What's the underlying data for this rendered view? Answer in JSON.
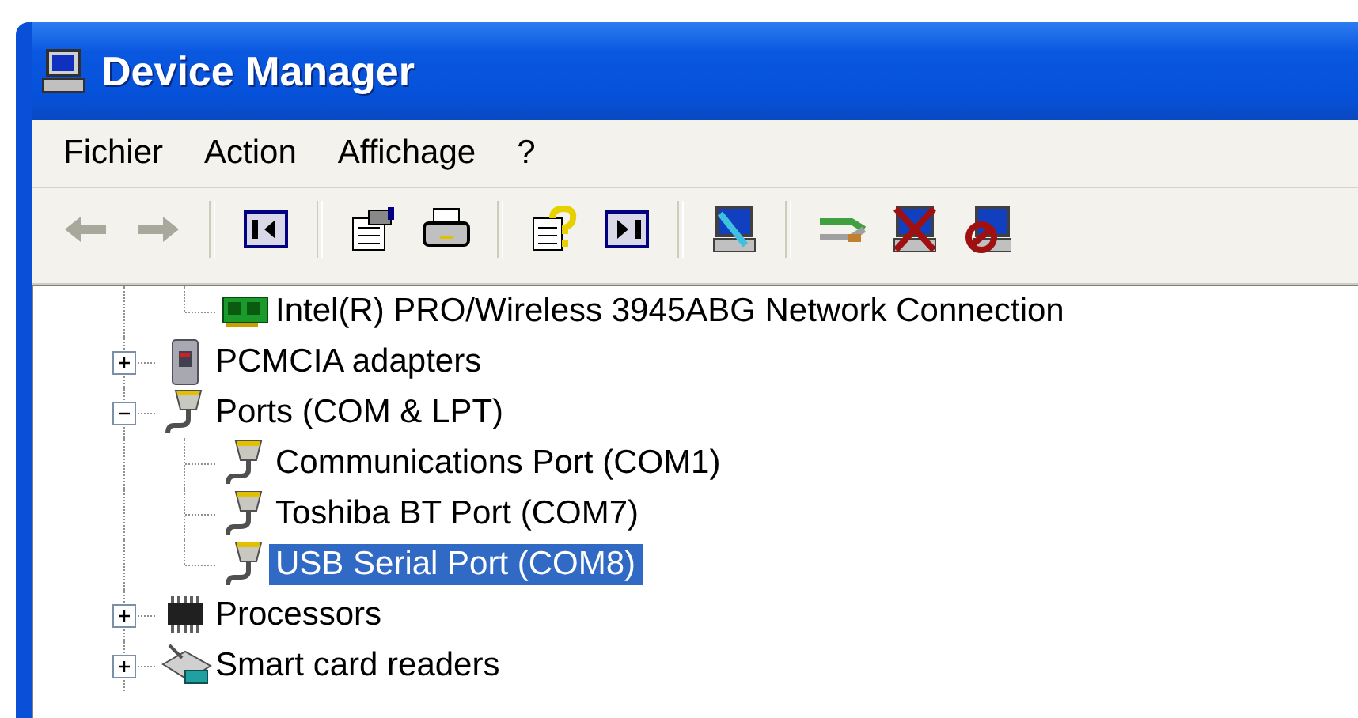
{
  "window": {
    "title": "Device Manager"
  },
  "menu": [
    {
      "label": "Fichier"
    },
    {
      "label": "Action"
    },
    {
      "label": "Affichage"
    },
    {
      "label": "?"
    }
  ],
  "toolbar": [
    {
      "kind": "back",
      "disabled": true
    },
    {
      "kind": "forward",
      "disabled": true
    },
    {
      "kind": "separator"
    },
    {
      "kind": "tree-toggle"
    },
    {
      "kind": "separator"
    },
    {
      "kind": "properties"
    },
    {
      "kind": "print"
    },
    {
      "kind": "separator"
    },
    {
      "kind": "help"
    },
    {
      "kind": "panel"
    },
    {
      "kind": "separator"
    },
    {
      "kind": "scan"
    },
    {
      "kind": "separator"
    },
    {
      "kind": "update"
    },
    {
      "kind": "uninstall"
    },
    {
      "kind": "disable"
    }
  ],
  "tree": {
    "items": [
      {
        "kind": "hidden",
        "children": [
          {
            "label": "Intel(R) PRO/Wireless 3945ABG Network Connection",
            "kind": "network",
            "selected": false
          }
        ]
      },
      {
        "label": "PCMCIA adapters",
        "kind": "pcmcia",
        "expanded": false
      },
      {
        "label": "Ports (COM & LPT)",
        "kind": "port",
        "expanded": true,
        "children": [
          {
            "label": "Communications Port (COM1)",
            "kind": "port",
            "selected": false
          },
          {
            "label": "Toshiba BT Port (COM7)",
            "kind": "port",
            "selected": false
          },
          {
            "label": "USB Serial Port (COM8)",
            "kind": "port",
            "selected": true
          }
        ]
      },
      {
        "label": "Processors",
        "kind": "processor",
        "expanded": false
      },
      {
        "label": "Smart card readers",
        "kind": "smartcard",
        "expanded": false
      }
    ]
  }
}
